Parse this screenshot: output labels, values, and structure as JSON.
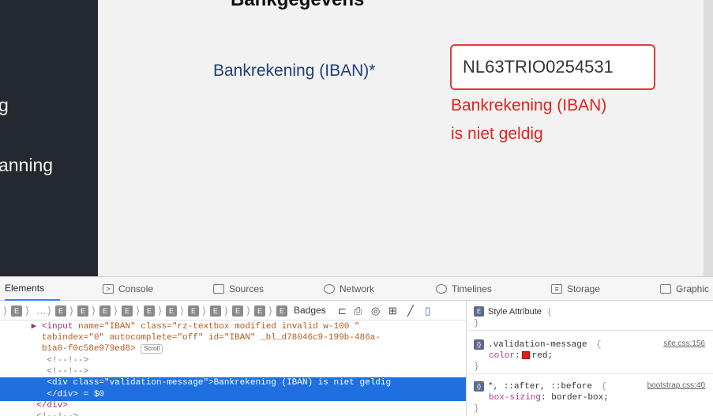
{
  "page": {
    "section_title": "Bankgegevens",
    "sidebar": {
      "items": [
        {
          "label": "g"
        },
        {
          "label": "anning"
        }
      ]
    },
    "iban_label": "Bankrekening (IBAN)*",
    "iban_value": "NL63TRIO0254531",
    "error_line1": "Bankrekening (IBAN)",
    "error_line2": "is niet geldig",
    "colors": {
      "error": "#e5231d",
      "label": "#1f3f7a",
      "sidebar": "#23292e"
    }
  },
  "devtools": {
    "tabs": [
      {
        "label": "Elements",
        "icon": "elements-icon"
      },
      {
        "label": "Console",
        "icon": "console-icon"
      },
      {
        "label": "Sources",
        "icon": "sources-icon"
      },
      {
        "label": "Network",
        "icon": "network-icon"
      },
      {
        "label": "Timelines",
        "icon": "timelines-icon"
      },
      {
        "label": "Storage",
        "icon": "storage-icon"
      },
      {
        "label": "Graphic",
        "icon": "graphics-icon"
      }
    ],
    "breadcrumb_ellipsis": "…",
    "badges_label": "Badges",
    "dom": {
      "line1_tag": "▶ <input",
      "line1_rest": " name=\"IBAN\" class=\"rz-textbox modified invalid w-100 \"",
      "line2": " tabindex=\"0\" autocomplete=\"off\" id=\"IBAN\" _bl_d78046c9-199b-486a-",
      "line3": " b1a0-f0c58e979ed8>",
      "scroll_badge": "Scroll",
      "comment1": "<!--!-->",
      "comment2": "<!--!-->",
      "selected_open": "<div class=\"validation-message\">",
      "selected_text": "Bankrekening (IBAN) is niet geldig",
      "selected_close": "</div>",
      "selected_ref": " = $0",
      "close_div": "</div>",
      "comment3": "<!--!-->"
    },
    "styles": {
      "style_attr": "Style Attribute",
      "rule1_selector": ".validation-message",
      "rule1_source": "site.css:156",
      "rule1_prop": "color",
      "rule1_value": "red",
      "rule2_selector": "*, ::after, ::before",
      "rule2_source": "bootstrap.css:40",
      "rule2_prop": "box-sizing",
      "rule2_value": "border-box"
    }
  }
}
